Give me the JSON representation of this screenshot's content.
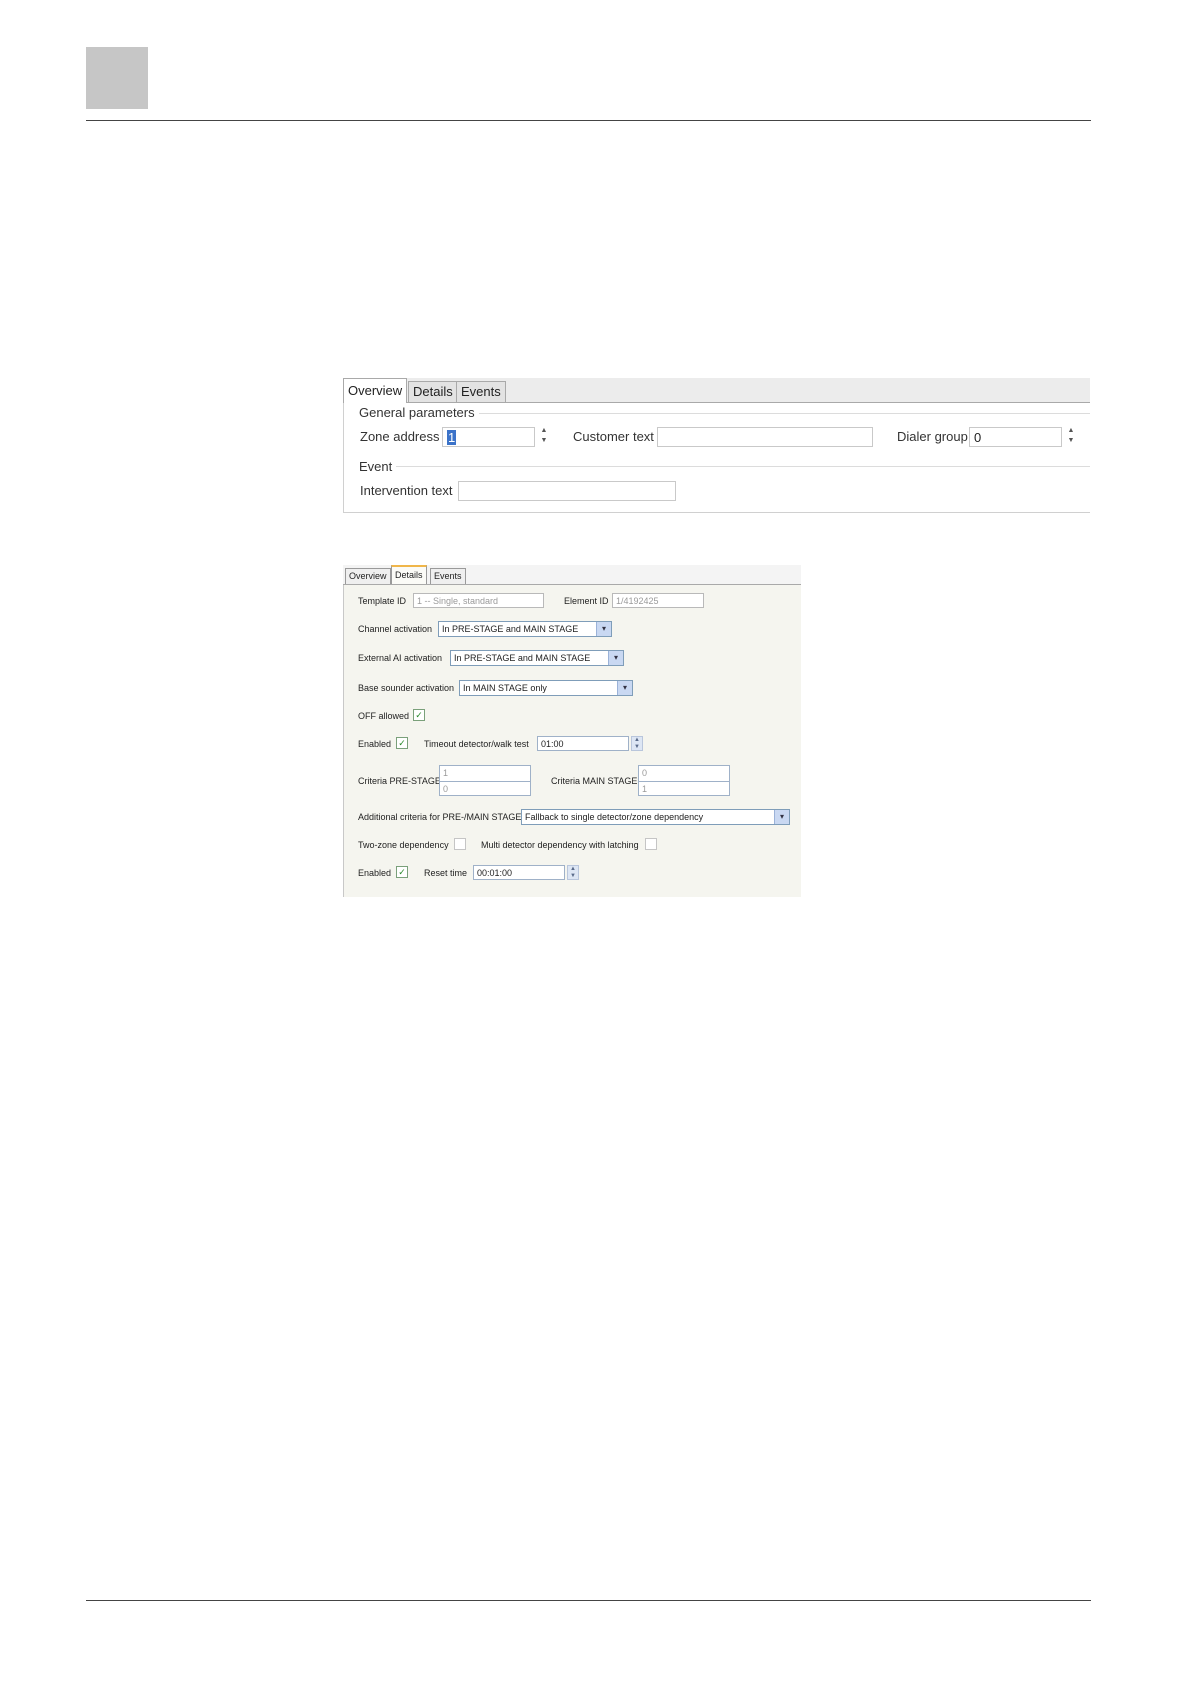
{
  "overview_panel": {
    "tabs": [
      "Overview",
      "Details",
      "Events"
    ],
    "active_tab": "Overview",
    "general_parameters_title": "General parameters",
    "zone_address_label": "Zone address",
    "zone_address_value": "1",
    "customer_text_label": "Customer text",
    "customer_text_value": "",
    "dialer_group_label": "Dialer group",
    "dialer_group_value": "0",
    "event_title": "Event",
    "intervention_text_label": "Intervention text",
    "intervention_text_value": ""
  },
  "details_panel": {
    "tabs": [
      "Overview",
      "Details",
      "Events"
    ],
    "active_tab": "Details",
    "template_id_label": "Template ID",
    "template_id_value": "1 -- Single, standard",
    "element_id_label": "Element ID",
    "element_id_value": "1/4192425",
    "channel_activation_label": "Channel activation",
    "channel_activation_value": "In PRE-STAGE and MAIN STAGE",
    "external_ai_activation_label": "External AI activation",
    "external_ai_activation_value": "In PRE-STAGE and MAIN STAGE",
    "base_sounder_activation_label": "Base sounder activation",
    "base_sounder_activation_value": "In MAIN STAGE only",
    "off_allowed_label": "OFF allowed",
    "off_allowed_checked": true,
    "enabled_label_1": "Enabled",
    "enabled_1_checked": true,
    "timeout_label": "Timeout detector/walk test",
    "timeout_value": "01:00",
    "criteria_pre_stage_label": "Criteria PRE-STAGE",
    "criteria_pre_stage_values": [
      "1",
      "0"
    ],
    "criteria_main_stage_label": "Criteria MAIN STAGE",
    "criteria_main_stage_values": [
      "0",
      "1"
    ],
    "additional_criteria_label": "Additional criteria for PRE-/MAIN STAGE",
    "additional_criteria_value": "Fallback to single detector/zone dependency",
    "two_zone_label": "Two-zone dependency",
    "two_zone_checked": false,
    "multi_detector_label": "Multi detector dependency with latching",
    "multi_detector_checked": false,
    "enabled_label_2": "Enabled",
    "enabled_2_checked": true,
    "reset_time_label": "Reset time",
    "reset_time_value": "00:01:00"
  },
  "icons": {
    "check_glyph": "✓",
    "dropdown_glyph": "▾",
    "spin_up_glyph": "▲",
    "spin_down_glyph": "▼"
  }
}
